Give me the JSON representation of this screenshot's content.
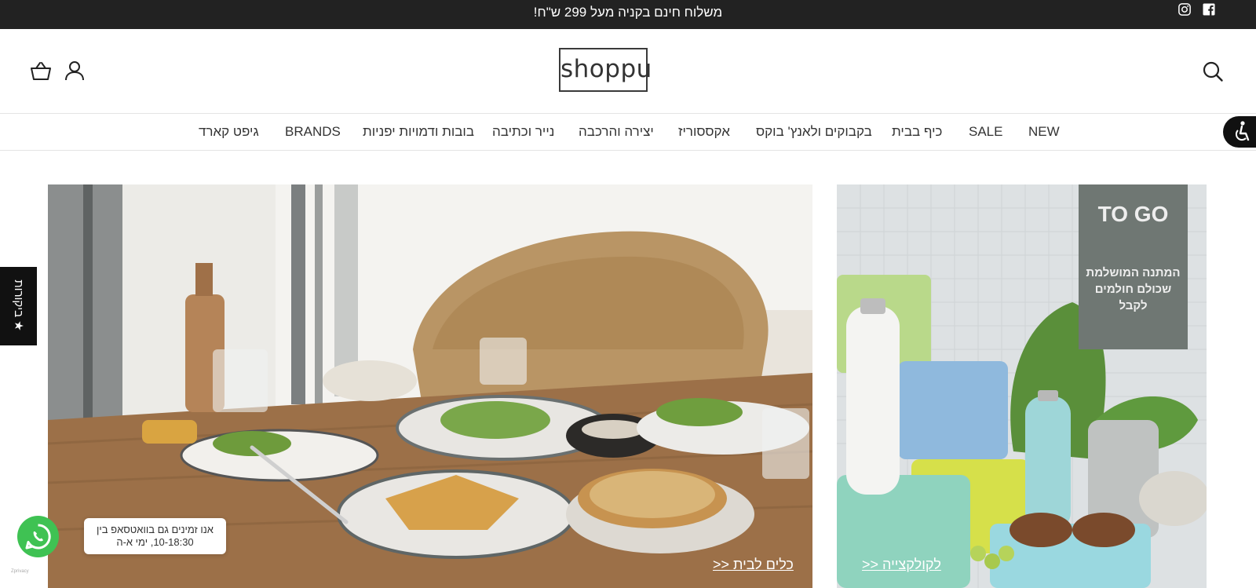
{
  "announcement": {
    "text": "משלוח חינם בקניה מעל 299 ש\"ח!"
  },
  "social": [
    {
      "icon": "instagram-icon"
    },
    {
      "icon": "facebook-icon"
    }
  ],
  "header": {
    "logo_text": "shoppu",
    "icons": [
      "search-icon",
      "account-icon",
      "cart-icon"
    ]
  },
  "nav": {
    "items": [
      {
        "label": "NEW"
      },
      {
        "label": "SALE"
      },
      {
        "label": "כיף בבית"
      },
      {
        "label": "בקבוקים ולאנץ' בוקס"
      },
      {
        "label": "אקססוריז"
      },
      {
        "label": "יצירה והרכבה"
      },
      {
        "label": "נייר וכתיבה"
      },
      {
        "label": "בובות ודמויות יפניות"
      },
      {
        "label": "BRANDS"
      },
      {
        "label": "גיפט קארד"
      }
    ]
  },
  "hero": {
    "left": {
      "link": "כלים לבית <<"
    },
    "right": {
      "link": "לקולקצייה <<",
      "title": "TO GO",
      "subtitle_line1": "המתנה המושלמת",
      "subtitle_line2": "שכולם חולמים לקבל"
    }
  },
  "reviews_tab": {
    "label": "★ ביקורות"
  },
  "whatsapp": {
    "line1": "אנו זמינים גם בוואטסאפ בין",
    "line2": "10-18:30, ימי א-ה",
    "credit": "Zprivacy"
  },
  "colors": {
    "topbar": "#222222",
    "whatsapp": "#3fc253",
    "accent": "#111111"
  }
}
